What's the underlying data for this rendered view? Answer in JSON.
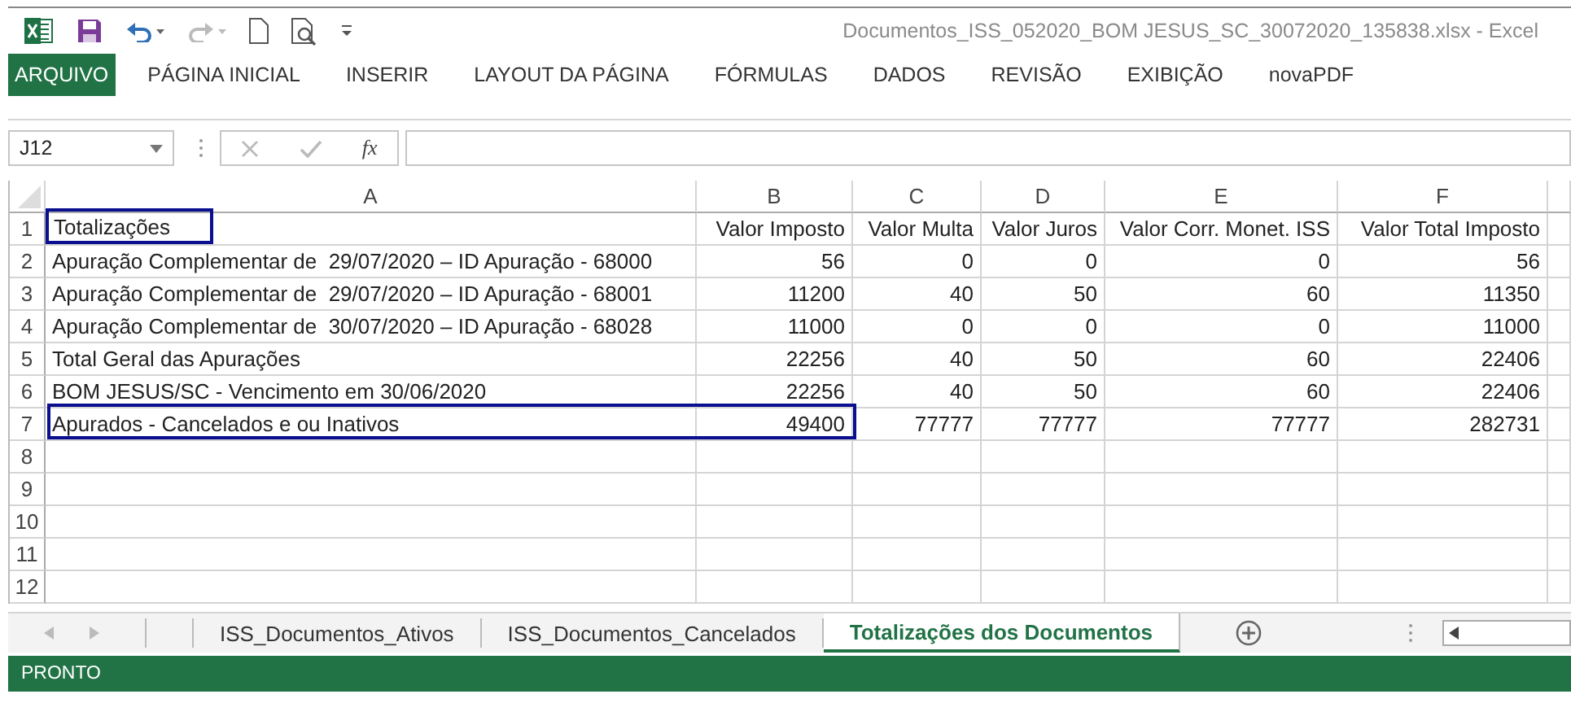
{
  "window": {
    "title": "Documentos_ISS_052020_BOM JESUS_SC_30072020_135838.xlsx - Excel"
  },
  "ribbon_tabs": [
    {
      "label": "ARQUIVO",
      "kind": "file"
    },
    {
      "label": "PÁGINA INICIAL",
      "kind": "tab"
    },
    {
      "label": "INSERIR",
      "kind": "tab"
    },
    {
      "label": "LAYOUT DA PÁGINA",
      "kind": "tab"
    },
    {
      "label": "FÓRMULAS",
      "kind": "tab"
    },
    {
      "label": "DADOS",
      "kind": "tab"
    },
    {
      "label": "REVISÃO",
      "kind": "tab"
    },
    {
      "label": "EXIBIÇÃO",
      "kind": "tab"
    },
    {
      "label": "novaPDF",
      "kind": "tab"
    }
  ],
  "name_box": {
    "value": "J12"
  },
  "formula_bar": {
    "fx": "fx"
  },
  "columns": [
    "A",
    "B",
    "C",
    "D",
    "E",
    "F"
  ],
  "rows": [
    {
      "number": "1",
      "cells": [
        {
          "value": "Totalizações",
          "outlined": true
        },
        {
          "value": "Valor Imposto",
          "outlined": false
        },
        {
          "value": "Valor Multa",
          "outlined": false
        },
        {
          "value": "Valor Juros",
          "outlined": false
        },
        {
          "value": "Valor Corr. Monet. ISS",
          "outlined": false
        },
        {
          "value": "Valor Total Imposto",
          "outlined": false
        }
      ]
    },
    {
      "number": "2",
      "cells": [
        {
          "value": "Apuração Complementar de  29/07/2020 – ID Apuração - 68000",
          "outlined": false
        },
        {
          "value": "56",
          "outlined": false
        },
        {
          "value": "0",
          "outlined": false
        },
        {
          "value": "0",
          "outlined": false
        },
        {
          "value": "0",
          "outlined": false
        },
        {
          "value": "56",
          "outlined": false
        }
      ]
    },
    {
      "number": "3",
      "cells": [
        {
          "value": "Apuração Complementar de  29/07/2020 – ID Apuração - 68001",
          "outlined": false
        },
        {
          "value": "11200",
          "outlined": false
        },
        {
          "value": "40",
          "outlined": false
        },
        {
          "value": "50",
          "outlined": false
        },
        {
          "value": "60",
          "outlined": false
        },
        {
          "value": "11350",
          "outlined": false
        }
      ]
    },
    {
      "number": "4",
      "cells": [
        {
          "value": "Apuração Complementar de  30/07/2020 – ID Apuração - 68028",
          "outlined": false
        },
        {
          "value": "11000",
          "outlined": false
        },
        {
          "value": "0",
          "outlined": false
        },
        {
          "value": "0",
          "outlined": false
        },
        {
          "value": "0",
          "outlined": false
        },
        {
          "value": "11000",
          "outlined": false
        }
      ]
    },
    {
      "number": "5",
      "cells": [
        {
          "value": "Total Geral das Apurações",
          "outlined": false
        },
        {
          "value": "22256",
          "outlined": false
        },
        {
          "value": "40",
          "outlined": false
        },
        {
          "value": "50",
          "outlined": false
        },
        {
          "value": "60",
          "outlined": false
        },
        {
          "value": "22406",
          "outlined": false
        }
      ]
    },
    {
      "number": "6",
      "cells": [
        {
          "value": "BOM JESUS/SC - Vencimento em 30/06/2020",
          "outlined": false
        },
        {
          "value": "22256",
          "outlined": false
        },
        {
          "value": "40",
          "outlined": false
        },
        {
          "value": "50",
          "outlined": false
        },
        {
          "value": "60",
          "outlined": false
        },
        {
          "value": "22406",
          "outlined": false
        }
      ]
    },
    {
      "number": "7",
      "cells": [
        {
          "value": "Apurados - Cancelados e ou Inativos",
          "outlined": true
        },
        {
          "value": "49400",
          "outlined": true
        },
        {
          "value": "77777",
          "outlined": false
        },
        {
          "value": "77777",
          "outlined": false
        },
        {
          "value": "77777",
          "outlined": false
        },
        {
          "value": "282731",
          "outlined": false
        }
      ]
    },
    {
      "number": "8",
      "cells": []
    },
    {
      "number": "9",
      "cells": []
    },
    {
      "number": "10",
      "cells": []
    },
    {
      "number": "11",
      "cells": []
    },
    {
      "number": "12",
      "cells": []
    }
  ],
  "sheet_tabs": [
    {
      "label": "ISS_Documentos_Ativos",
      "selected": false
    },
    {
      "label": "ISS_Documentos_Cancelados",
      "selected": false
    },
    {
      "label": "Totalizações dos Documentos",
      "selected": true
    }
  ],
  "status_bar": {
    "text": "PRONTO"
  }
}
